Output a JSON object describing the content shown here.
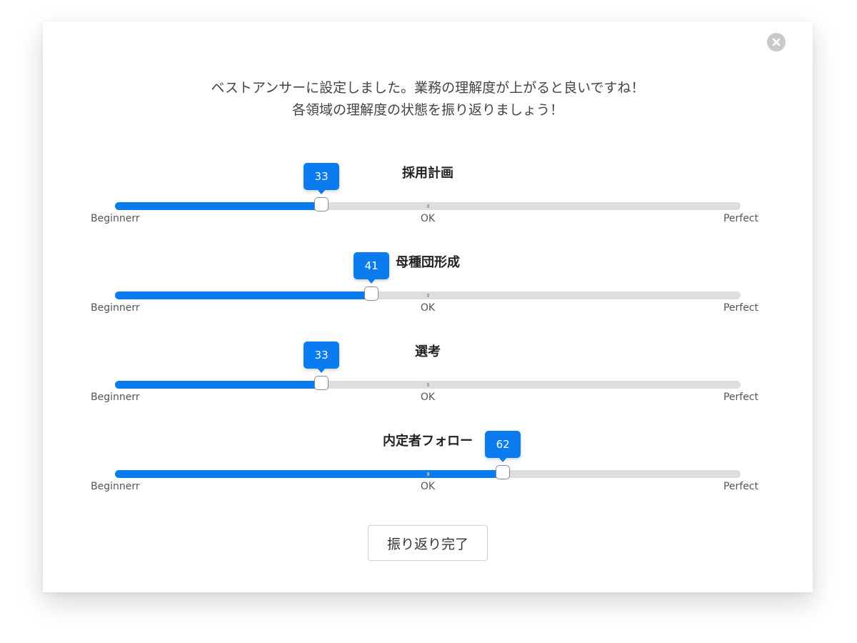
{
  "message": {
    "line1": "ベストアンサーに設定しました。業務の理解度が上がると良いですね！",
    "line2": "各領域の理解度の状態を振り返りましょう！"
  },
  "scale": {
    "min": 0,
    "max": 100,
    "min_label": "Beginnerr",
    "mid_label": "OK",
    "max_label": "Perfect"
  },
  "sliders": [
    {
      "title": "採用計画",
      "value": 33
    },
    {
      "title": "母種団形成",
      "value": 41
    },
    {
      "title": "選考",
      "value": 33
    },
    {
      "title": "内定者フォロー",
      "value": 62
    }
  ],
  "done_button": {
    "label": "振り返り完了"
  },
  "colors": {
    "accent": "#0a7cf0",
    "track": "#dedede",
    "close": "#c9c9c9"
  }
}
